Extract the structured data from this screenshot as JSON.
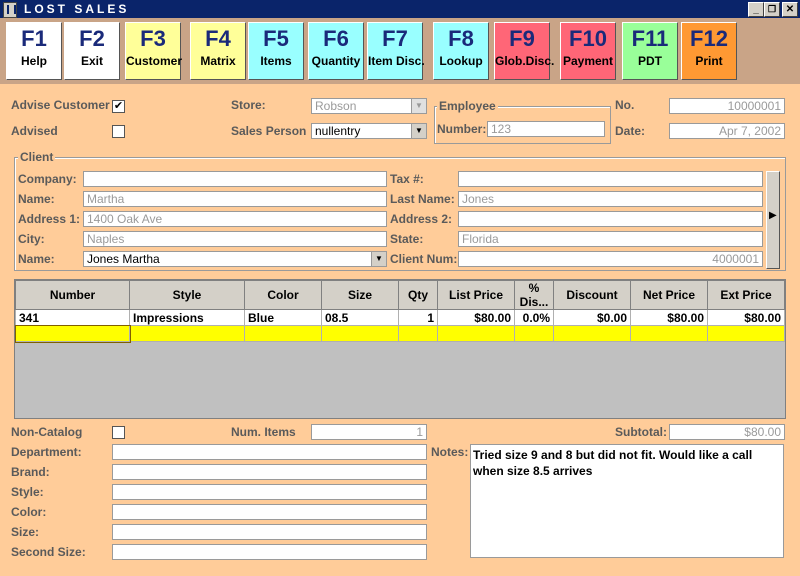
{
  "window": {
    "title": "LOST SALES",
    "min": "_",
    "max": "❐",
    "close": "✕"
  },
  "toolbar": [
    {
      "key": "F1",
      "label": "Help",
      "bg": "#ffffff"
    },
    {
      "key": "F2",
      "label": "Exit",
      "bg": "#ffffff"
    },
    {
      "key": "F3",
      "label": "Customer",
      "bg": "#ffff99"
    },
    {
      "key": "F4",
      "label": "Matrix",
      "bg": "#ffff99"
    },
    {
      "key": "F5",
      "label": "Items",
      "bg": "#99ffff"
    },
    {
      "key": "F6",
      "label": "Quantity",
      "bg": "#99ffff"
    },
    {
      "key": "F7",
      "label": "Item Disc.",
      "bg": "#99ffff"
    },
    {
      "key": "F8",
      "label": "Lookup",
      "bg": "#99ffff"
    },
    {
      "key": "F9",
      "label": "Glob.Disc.",
      "bg": "#ff6677"
    },
    {
      "key": "F10",
      "label": "Payment",
      "bg": "#ff6677"
    },
    {
      "key": "F11",
      "label": "PDT",
      "bg": "#99ff99"
    },
    {
      "key": "F12",
      "label": "Print",
      "bg": "#ff9933"
    }
  ],
  "header": {
    "advise_customer_label": "Advise Customer",
    "advise_customer_check": "✔",
    "advised_label": "Advised",
    "store_label": "Store:",
    "store_value": "Robson",
    "sales_person_label": "Sales Person",
    "sales_person_value": "nullentry",
    "employee_group": "Employee",
    "number_label": "Number:",
    "number_value": "123",
    "no_label": "No.",
    "no_value": "10000001",
    "date_label": "Date:",
    "date_value": "Apr 7, 2002"
  },
  "client": {
    "group": "Client",
    "company_label": "Company:",
    "company_value": "",
    "name_label": "Name:",
    "name_value": "Martha",
    "address1_label": "Address 1:",
    "address1_value": "1400 Oak Ave",
    "city_label": "City:",
    "city_value": "Naples",
    "name2_label": "Name:",
    "name2_value": "Jones Martha",
    "tax_label": "Tax #:",
    "tax_value": "",
    "lastname_label": "Last Name:",
    "lastname_value": "Jones",
    "address2_label": "Address 2:",
    "address2_value": "",
    "state_label": "State:",
    "state_value": "Florida",
    "clientnum_label": "Client Num:",
    "clientnum_value": "4000001"
  },
  "table": {
    "columns": [
      "Number",
      "Style",
      "Color",
      "Size",
      "Qty",
      "List Price",
      "% Dis...",
      "Discount",
      "Net Price",
      "Ext Price"
    ],
    "rows": [
      [
        "341",
        "Impressions",
        "Blue",
        "08.5",
        "1",
        "$80.00",
        "0.0%",
        "$0.00",
        "$80.00",
        "$80.00"
      ],
      [
        "",
        "",
        "",
        "",
        "",
        "",
        "",
        "",
        "",
        ""
      ]
    ]
  },
  "footer": {
    "noncatalog_label": "Non-Catalog",
    "numitems_label": "Num. Items",
    "numitems_value": "1",
    "subtotal_label": "Subtotal:",
    "subtotal_value": "$80.00",
    "department_label": "Department:",
    "brand_label": "Brand:",
    "style_label": "Style:",
    "color_label": "Color:",
    "size_label": "Size:",
    "second_size_label": "Second Size:",
    "notes_label": "Notes:",
    "notes_value": "Tried size 9 and 8 but did not fit. Would like a call when size 8.5 arrives"
  }
}
